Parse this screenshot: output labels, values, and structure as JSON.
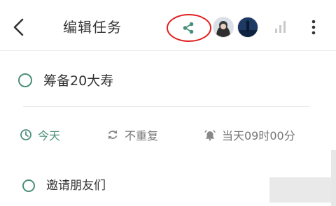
{
  "header": {
    "title": "编辑任务",
    "icons": {
      "back": "chevron-left-icon",
      "share": "share-icon",
      "signal": "signal-bars-icon",
      "more": "more-vertical-icon"
    },
    "members": [
      "avatar-1",
      "avatar-2"
    ]
  },
  "task": {
    "title": "筹备20大寿",
    "completed": false
  },
  "meta": {
    "date_label": "今天",
    "repeat_label": "不重复",
    "reminder_label": "当天09时00分"
  },
  "subtasks": [
    {
      "title": "邀请朋友们",
      "completed": false
    }
  ],
  "colors": {
    "accent": "#4a8f7a",
    "highlight_ring": "#e02020",
    "text": "#333333",
    "muted": "#777777"
  }
}
